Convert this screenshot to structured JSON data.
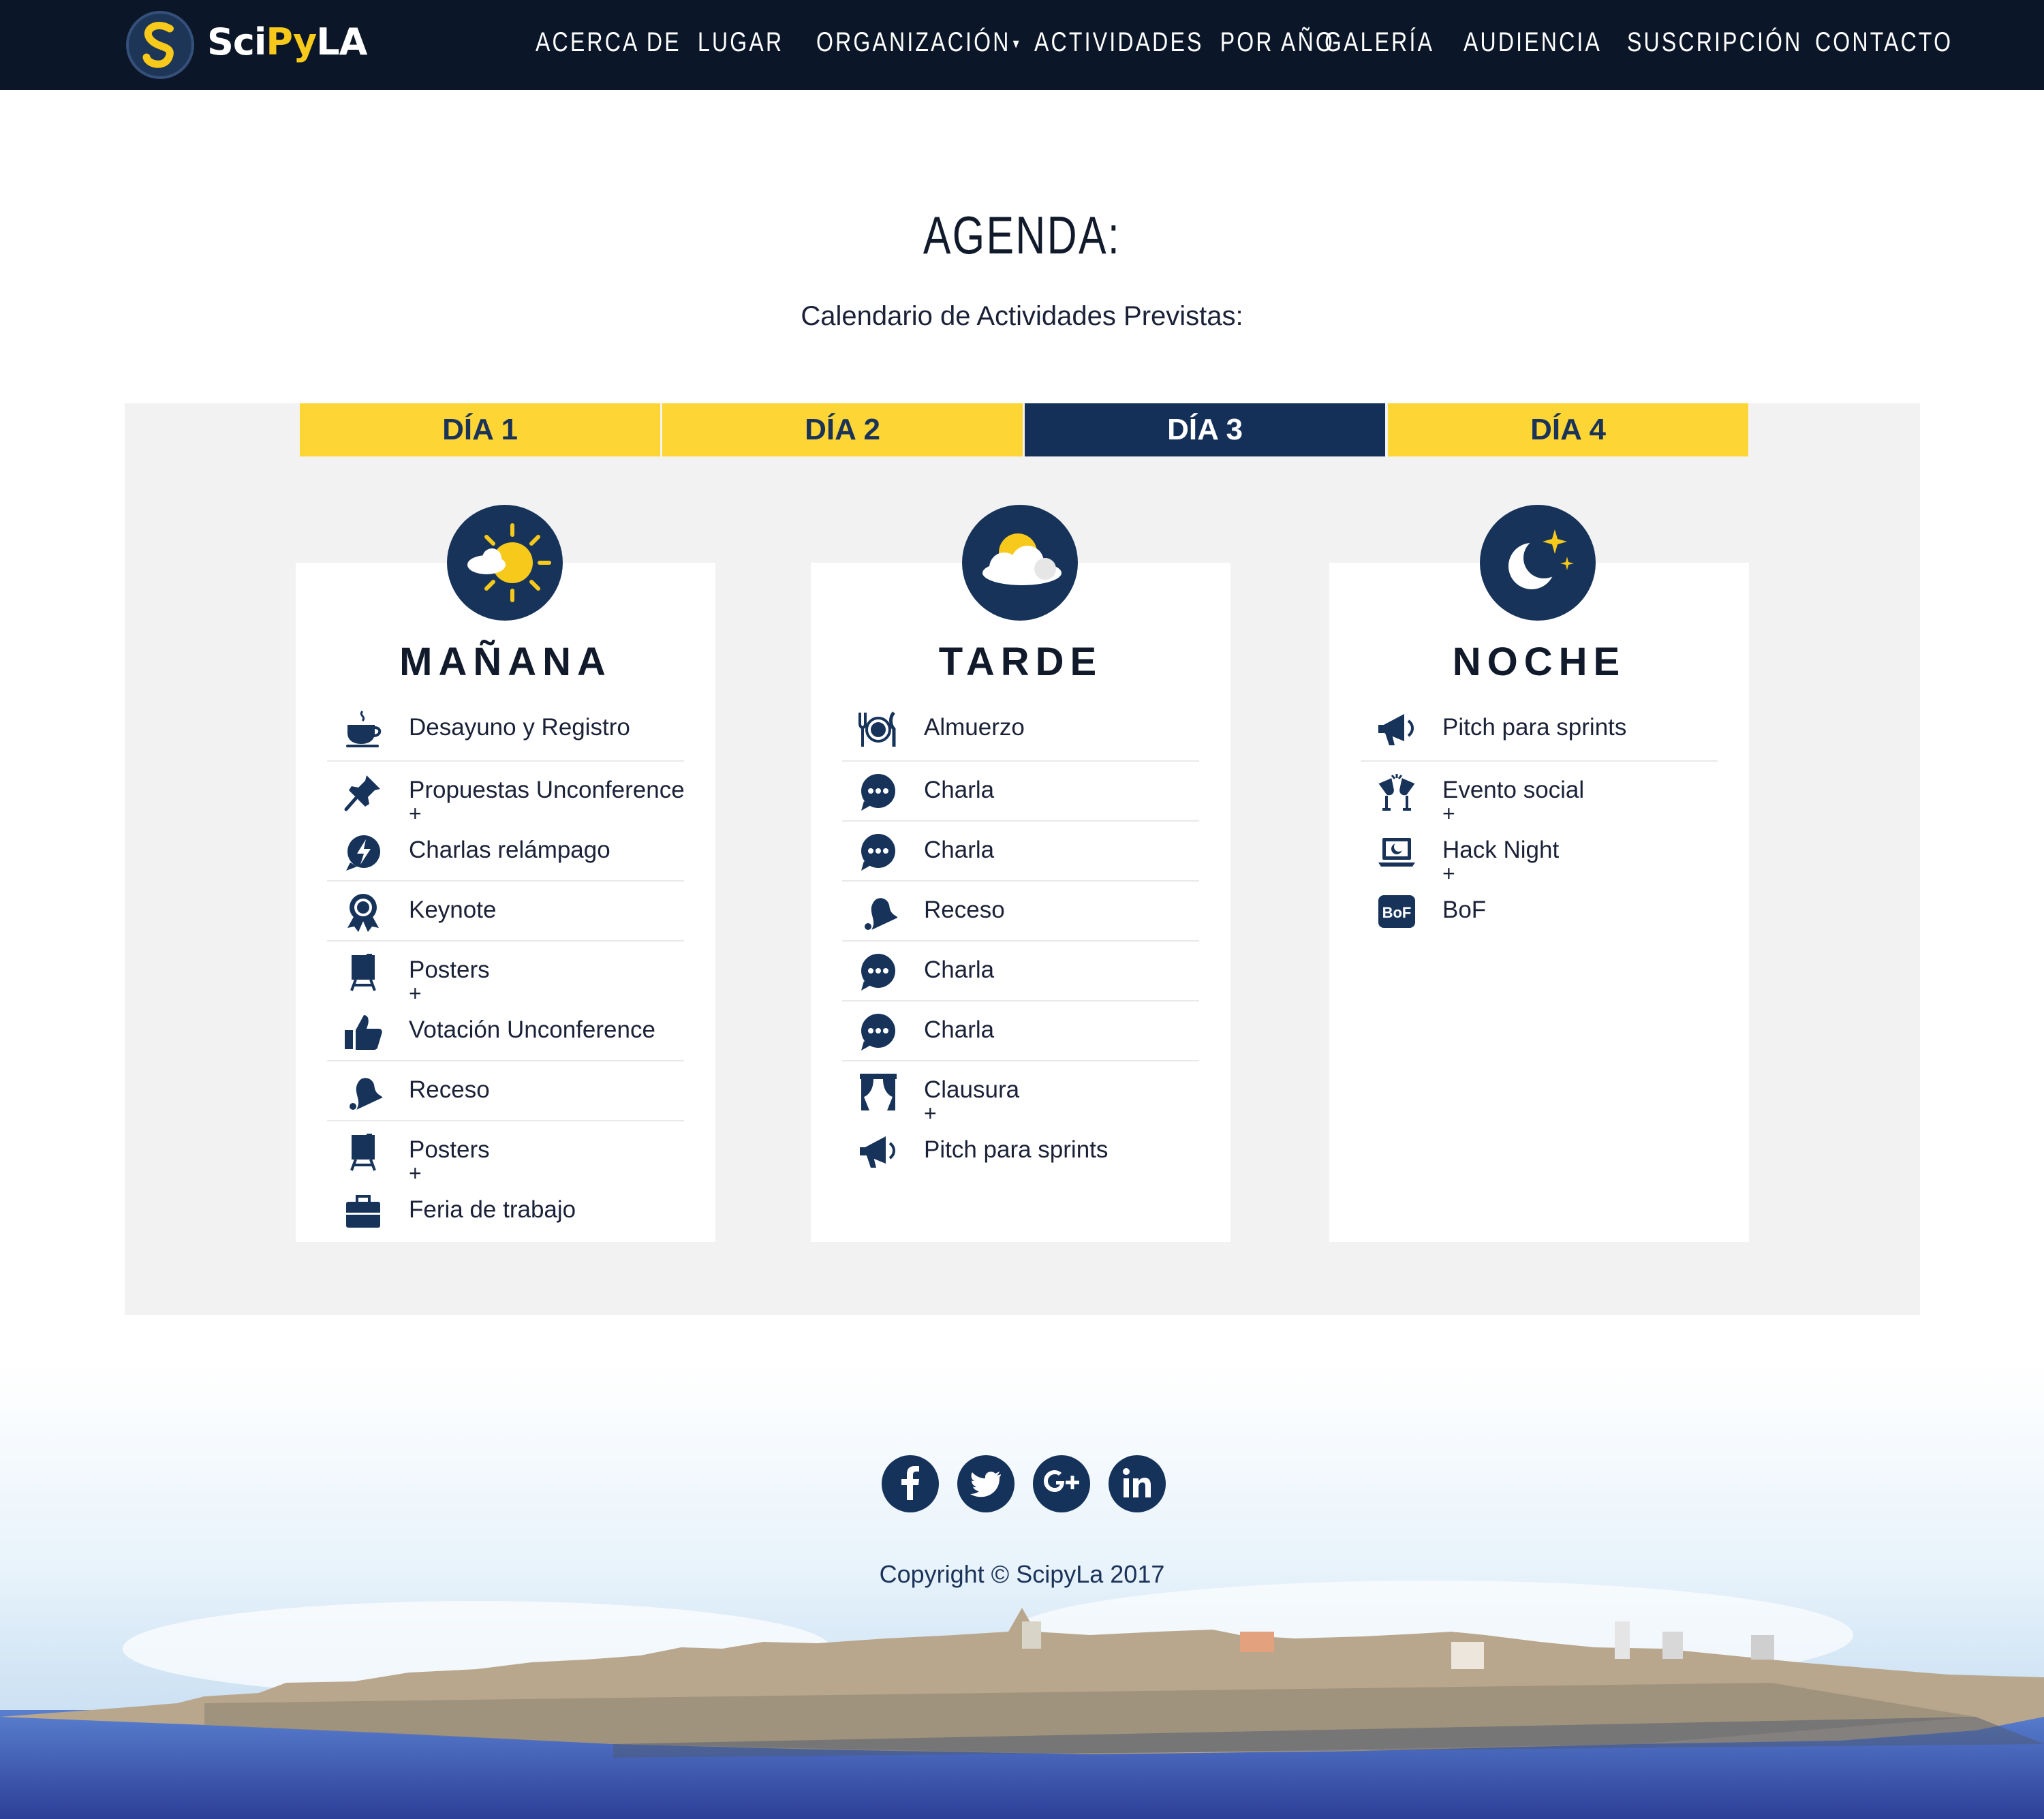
{
  "brand": {
    "name_a": "Sci",
    "name_b": "Py",
    "name_c": "LA",
    "logo_icon": "snake-s-logo-icon"
  },
  "nav": {
    "items": [
      {
        "label": "ACERCA DE"
      },
      {
        "label": "LUGAR"
      },
      {
        "label": "ORGANIZACIÓN",
        "dropdown": true
      },
      {
        "label": "ACTIVIDADES  POR AÑO"
      },
      {
        "label": "GALERÍA"
      },
      {
        "label": "AUDIENCIA"
      },
      {
        "label": "SUSCRIPCIÓN"
      },
      {
        "label": "CONTACTO"
      }
    ]
  },
  "agenda": {
    "title": "AGENDA:",
    "subtitle": "Calendario de Actividades Previstas:",
    "tabs": [
      {
        "label": "DÍA 1",
        "active": false
      },
      {
        "label": "DÍA 2",
        "active": false
      },
      {
        "label": "DÍA 3",
        "active": true
      },
      {
        "label": "DÍA 4",
        "active": false
      }
    ],
    "cards": [
      {
        "title": "MAÑANA",
        "icon": "sun-cloud-icon",
        "items": [
          {
            "entries": [
              {
                "icon": "coffee-cup-icon",
                "label": "Desayuno y Registro"
              }
            ]
          },
          {
            "entries": [
              {
                "icon": "pushpin-icon",
                "label": "Propuestas Unconference"
              },
              {
                "icon": "lightning-bubble-icon",
                "label": "Charlas relámpago"
              }
            ]
          },
          {
            "entries": [
              {
                "icon": "award-ribbon-icon",
                "label": "Keynote"
              }
            ]
          },
          {
            "entries": [
              {
                "icon": "easel-icon",
                "label": "Posters"
              },
              {
                "icon": "thumbs-up-icon",
                "label": "Votación Unconference"
              }
            ]
          },
          {
            "entries": [
              {
                "icon": "bell-icon",
                "label": "Receso"
              }
            ]
          },
          {
            "entries": [
              {
                "icon": "easel-icon",
                "label": "Posters"
              },
              {
                "icon": "briefcase-icon",
                "label": "Feria de trabajo"
              }
            ]
          }
        ]
      },
      {
        "title": "TARDE",
        "icon": "cloud-sun-icon",
        "items": [
          {
            "entries": [
              {
                "icon": "plate-cutlery-icon",
                "label": "Almuerzo"
              }
            ]
          },
          {
            "entries": [
              {
                "icon": "chat-bubble-icon",
                "label": "Charla"
              }
            ]
          },
          {
            "entries": [
              {
                "icon": "chat-bubble-icon",
                "label": "Charla"
              }
            ]
          },
          {
            "entries": [
              {
                "icon": "bell-icon",
                "label": "Receso"
              }
            ]
          },
          {
            "entries": [
              {
                "icon": "chat-bubble-icon",
                "label": "Charla"
              }
            ]
          },
          {
            "entries": [
              {
                "icon": "chat-bubble-icon",
                "label": "Charla"
              }
            ]
          },
          {
            "entries": [
              {
                "icon": "curtains-icon",
                "label": "Clausura"
              },
              {
                "icon": "megaphone-icon",
                "label": "Pitch para sprints"
              }
            ]
          }
        ]
      },
      {
        "title": "NOCHE",
        "icon": "moon-stars-icon",
        "items": [
          {
            "entries": [
              {
                "icon": "megaphone-icon",
                "label": "Pitch para sprints"
              }
            ]
          },
          {
            "entries": [
              {
                "icon": "toast-glasses-icon",
                "label": "Evento social"
              },
              {
                "icon": "laptop-moon-icon",
                "label": "Hack Night"
              },
              {
                "icon": "bof-badge-icon",
                "label": "BoF"
              }
            ]
          }
        ]
      }
    ],
    "plus": "+"
  },
  "footer": {
    "socials": [
      "facebook-icon",
      "twitter-icon",
      "google-plus-icon",
      "linkedin-icon"
    ],
    "copyright": "Copyright © ScipyLa 2017"
  },
  "colors": {
    "navy": "#143058",
    "yellow": "#fdd635",
    "nav_bg": "#0b1728",
    "panel_bg": "#f2f2f2"
  }
}
